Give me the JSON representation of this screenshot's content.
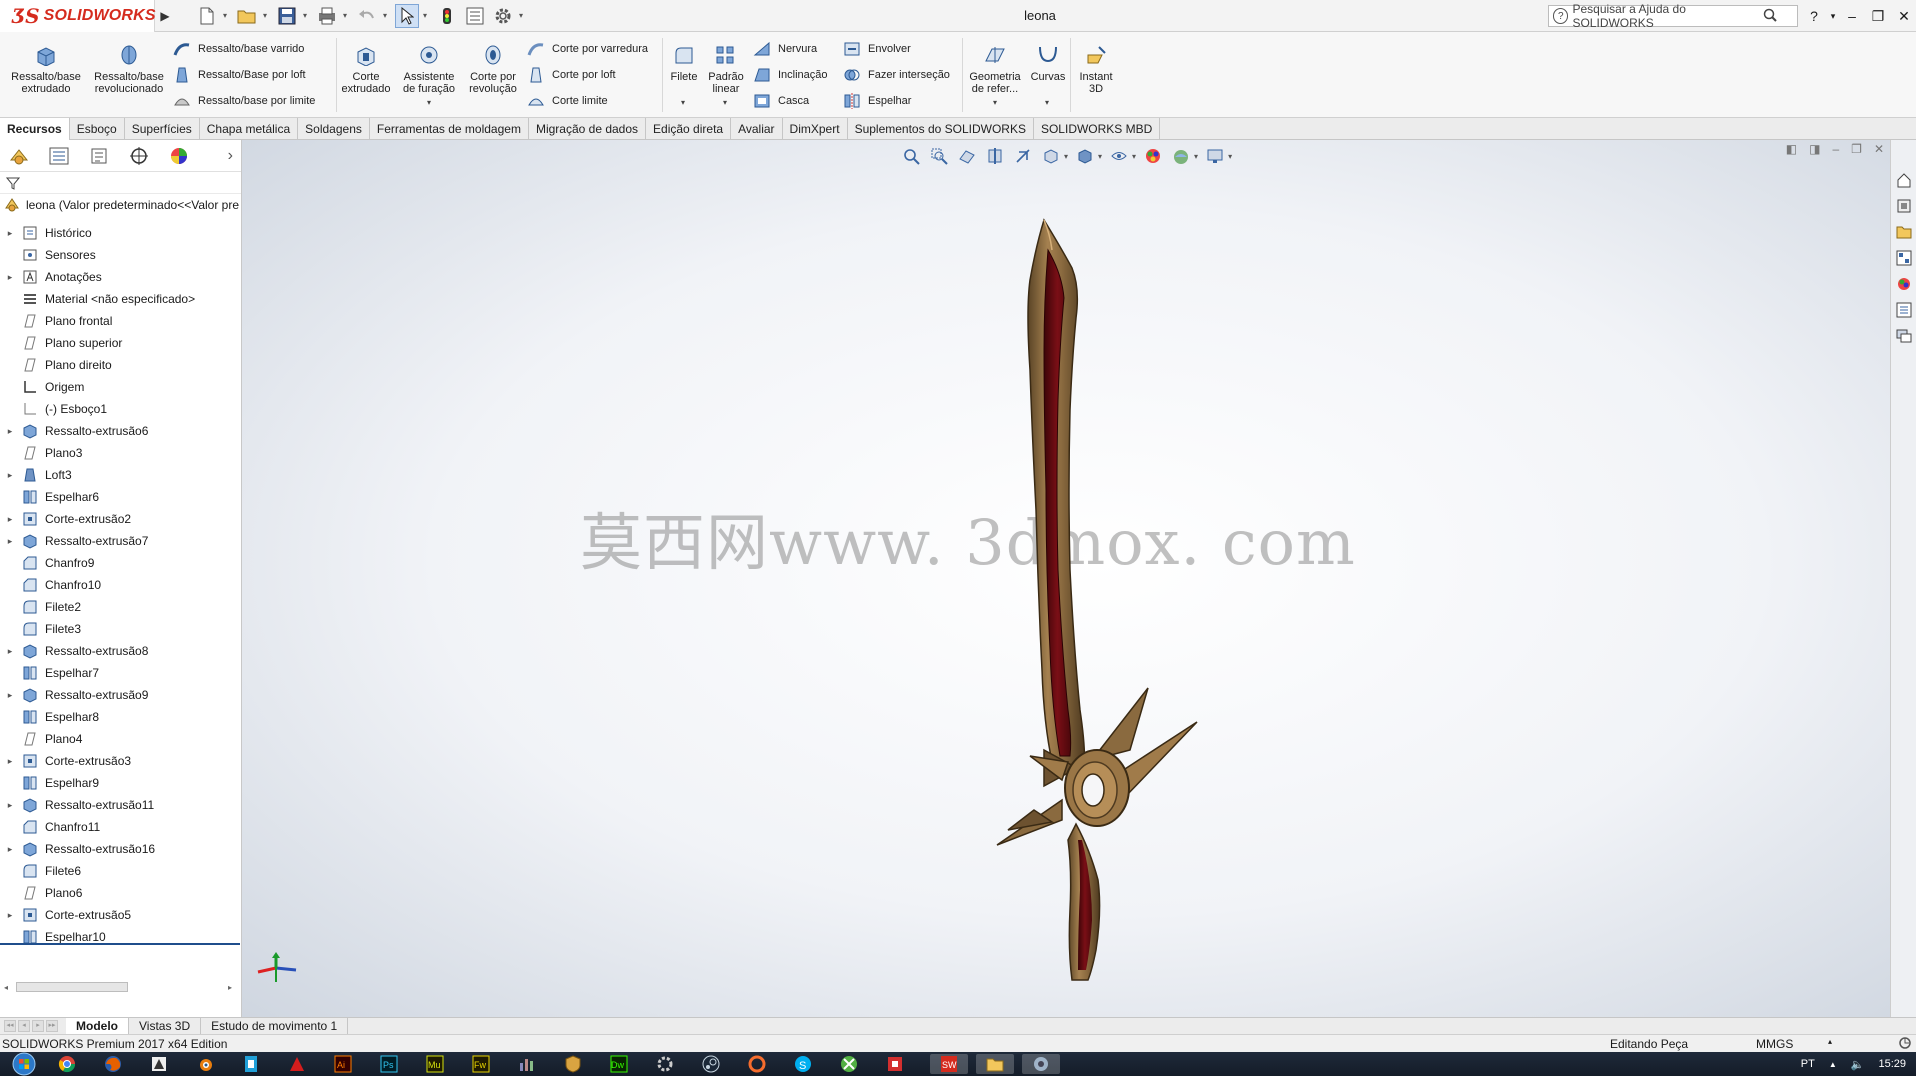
{
  "app": {
    "brand": "SOLIDWORKS",
    "document_title": "leona",
    "search_placeholder": "Pesquisar a Ajuda do SOLIDWORKS",
    "brand_color": "#d52b1e"
  },
  "ribbon": {
    "big_buttons": [
      {
        "label": "Ressalto/base extrudado",
        "icon": "extruded-boss-icon"
      },
      {
        "label": "Ressalto/base revolucionado",
        "icon": "revolved-boss-icon"
      },
      {
        "label": "Corte extrudado",
        "icon": "extruded-cut-icon"
      },
      {
        "label": "Assistente de furação",
        "icon": "hole-wizard-icon"
      },
      {
        "label": "Corte por revolução",
        "icon": "revolved-cut-icon"
      },
      {
        "label": "Filete",
        "icon": "fillet-icon"
      },
      {
        "label": "Padrão linear",
        "icon": "linear-pattern-icon"
      },
      {
        "label": "Geometria de refer...",
        "icon": "reference-geometry-icon"
      },
      {
        "label": "Curvas",
        "icon": "curves-icon"
      },
      {
        "label": "Instant 3D",
        "icon": "instant3d-icon"
      }
    ],
    "small_buttons": [
      {
        "label": "Ressalto/base varrido",
        "icon": "swept-boss-icon"
      },
      {
        "label": "Ressalto/Base por loft",
        "icon": "lofted-boss-icon"
      },
      {
        "label": "Ressalto/base por limite",
        "icon": "boundary-boss-icon"
      },
      {
        "label": "Corte por varredura",
        "icon": "swept-cut-icon"
      },
      {
        "label": "Corte por loft",
        "icon": "lofted-cut-icon"
      },
      {
        "label": "Corte limite",
        "icon": "boundary-cut-icon"
      },
      {
        "label": "Nervura",
        "icon": "rib-icon"
      },
      {
        "label": "Inclinação",
        "icon": "draft-icon"
      },
      {
        "label": "Casca",
        "icon": "shell-icon"
      },
      {
        "label": "Envolver",
        "icon": "wrap-icon"
      },
      {
        "label": "Fazer interseção",
        "icon": "intersect-icon"
      },
      {
        "label": "Espelhar",
        "icon": "mirror-icon"
      }
    ]
  },
  "tabs": [
    "Recursos",
    "Esboço",
    "Superfícies",
    "Chapa metálica",
    "Soldagens",
    "Ferramentas de moldagem",
    "Migração de dados",
    "Edição direta",
    "Avaliar",
    "DimXpert",
    "Suplementos do SOLIDWORKS",
    "SOLIDWORKS MBD"
  ],
  "active_tab": "Recursos",
  "tree": {
    "root": "leona  (Valor predeterminado<<Valor pre",
    "items": [
      {
        "label": "Histórico",
        "icon": "history-icon",
        "expandable": true
      },
      {
        "label": "Sensores",
        "icon": "sensor-icon",
        "expandable": false
      },
      {
        "label": "Anotações",
        "icon": "annotations-icon",
        "expandable": true
      },
      {
        "label": "Material <não especificado>",
        "icon": "material-icon",
        "expandable": false
      },
      {
        "label": "Plano frontal",
        "icon": "plane-icon",
        "expandable": false
      },
      {
        "label": "Plano superior",
        "icon": "plane-icon",
        "expandable": false
      },
      {
        "label": "Plano direito",
        "icon": "plane-icon",
        "expandable": false
      },
      {
        "label": "Origem",
        "icon": "origin-icon",
        "expandable": false
      },
      {
        "label": "(-) Esboço1",
        "icon": "sketch-icon",
        "expandable": false
      },
      {
        "label": "Ressalto-extrusão6",
        "icon": "extrude-feature-icon",
        "expandable": true
      },
      {
        "label": "Plano3",
        "icon": "plane-icon",
        "expandable": false
      },
      {
        "label": "Loft3",
        "icon": "loft-feature-icon",
        "expandable": true
      },
      {
        "label": "Espelhar6",
        "icon": "mirror-feature-icon",
        "expandable": false
      },
      {
        "label": "Corte-extrusão2",
        "icon": "cut-feature-icon",
        "expandable": true
      },
      {
        "label": "Ressalto-extrusão7",
        "icon": "extrude-feature-icon",
        "expandable": true
      },
      {
        "label": "Chanfro9",
        "icon": "chamfer-feature-icon",
        "expandable": false
      },
      {
        "label": "Chanfro10",
        "icon": "chamfer-feature-icon",
        "expandable": false
      },
      {
        "label": "Filete2",
        "icon": "fillet-feature-icon",
        "expandable": false
      },
      {
        "label": "Filete3",
        "icon": "fillet-feature-icon",
        "expandable": false
      },
      {
        "label": "Ressalto-extrusão8",
        "icon": "extrude-feature-icon",
        "expandable": true
      },
      {
        "label": "Espelhar7",
        "icon": "mirror-feature-icon",
        "expandable": false
      },
      {
        "label": "Ressalto-extrusão9",
        "icon": "extrude-feature-icon",
        "expandable": true
      },
      {
        "label": "Espelhar8",
        "icon": "mirror-feature-icon",
        "expandable": false
      },
      {
        "label": "Plano4",
        "icon": "plane-icon",
        "expandable": false
      },
      {
        "label": "Corte-extrusão3",
        "icon": "cut-feature-icon",
        "expandable": true
      },
      {
        "label": "Espelhar9",
        "icon": "mirror-feature-icon",
        "expandable": false
      },
      {
        "label": "Ressalto-extrusão11",
        "icon": "extrude-feature-icon",
        "expandable": true
      },
      {
        "label": "Chanfro11",
        "icon": "chamfer-feature-icon",
        "expandable": false
      },
      {
        "label": "Ressalto-extrusão16",
        "icon": "extrude-feature-icon",
        "expandable": true
      },
      {
        "label": "Filete6",
        "icon": "fillet-feature-icon",
        "expandable": false
      },
      {
        "label": "Plano6",
        "icon": "plane-icon",
        "expandable": false
      },
      {
        "label": "Corte-extrusão5",
        "icon": "cut-feature-icon",
        "expandable": true
      },
      {
        "label": "Espelhar10",
        "icon": "mirror-feature-icon",
        "expandable": false
      }
    ]
  },
  "viewport": {
    "watermark": "莫西网www. 3dmox. com",
    "model_colors": {
      "bronze": "#8a6a3f",
      "bronze_light": "#b08a55",
      "bronze_dark": "#4e3a20",
      "crimson": "#6b0c12"
    }
  },
  "model_tabs": [
    "Modelo",
    "Vistas 3D",
    "Estudo de movimento 1"
  ],
  "active_model_tab": "Modelo",
  "status": {
    "version": "SOLIDWORKS Premium 2017 x64 Edition",
    "mode": "Editando Peça",
    "units": "MMGS"
  },
  "taskbar": {
    "language": "PT",
    "time": "15:29"
  }
}
